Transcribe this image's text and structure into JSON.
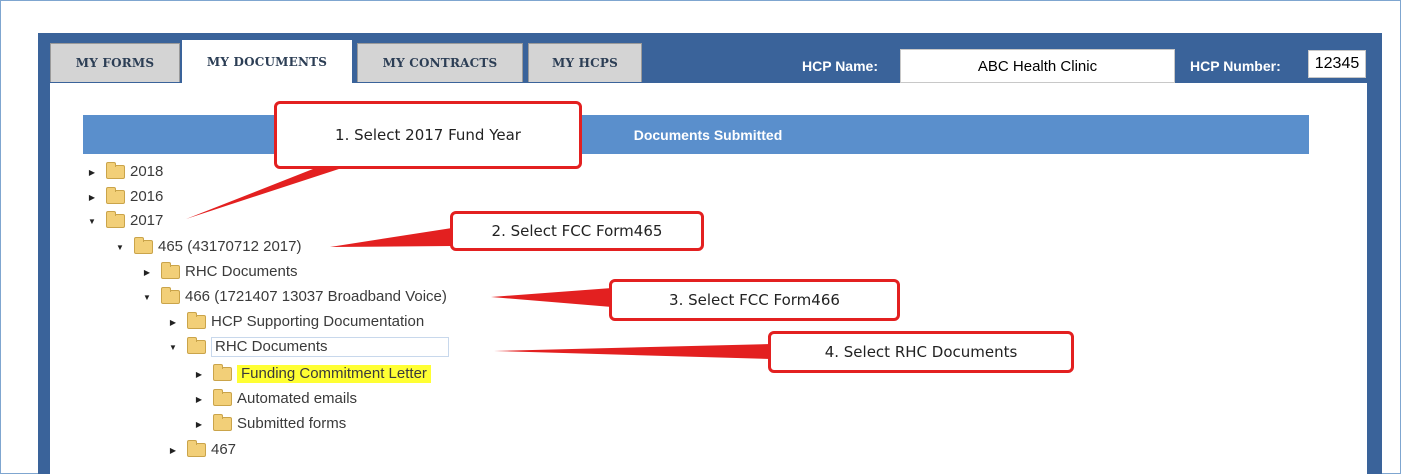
{
  "tabs": [
    {
      "label": "MY FORMS"
    },
    {
      "label": "MY DOCUMENTS",
      "active": true
    },
    {
      "label": "MY CONTRACTS"
    },
    {
      "label": "MY HCPS"
    }
  ],
  "hcp": {
    "name_label": "HCP Name:",
    "name_value": "ABC Health Clinic",
    "number_label": "HCP Number:",
    "number_value": "12345"
  },
  "documents_header": "Documents Submitted",
  "tree": [
    {
      "label": "2018",
      "expanded": false
    },
    {
      "label": "2016",
      "expanded": false
    },
    {
      "label": "2017",
      "expanded": true
    },
    {
      "label": "465 (43170712 2017)",
      "expanded": true
    },
    {
      "label": "RHC Documents",
      "expanded": false
    },
    {
      "label": "466 (1721407 13037 Broadband Voice)",
      "expanded": true
    },
    {
      "label": "HCP Supporting Documentation",
      "expanded": false
    },
    {
      "label": "RHC Documents",
      "expanded": true,
      "selected": true
    },
    {
      "label": "Funding Commitment Letter",
      "expanded": false,
      "highlighted": true
    },
    {
      "label": "Automated emails",
      "expanded": false
    },
    {
      "label": "Submitted forms",
      "expanded": false
    },
    {
      "label": "467",
      "expanded": false
    }
  ],
  "callouts": [
    {
      "text": "1. Select 2017 Fund Year"
    },
    {
      "text": "2. Select FCC Form465"
    },
    {
      "text": "3. Select FCC Form466"
    },
    {
      "text": "4. Select RHC Documents"
    }
  ],
  "colors": {
    "panel": "#3a639a",
    "header_bar": "#5a8fcc",
    "callout_border": "#e32020",
    "highlight": "#ffff33"
  },
  "icons": {
    "collapsed": "triangle-right-icon",
    "expanded": "triangle-down-icon",
    "folder": "folder-icon"
  }
}
